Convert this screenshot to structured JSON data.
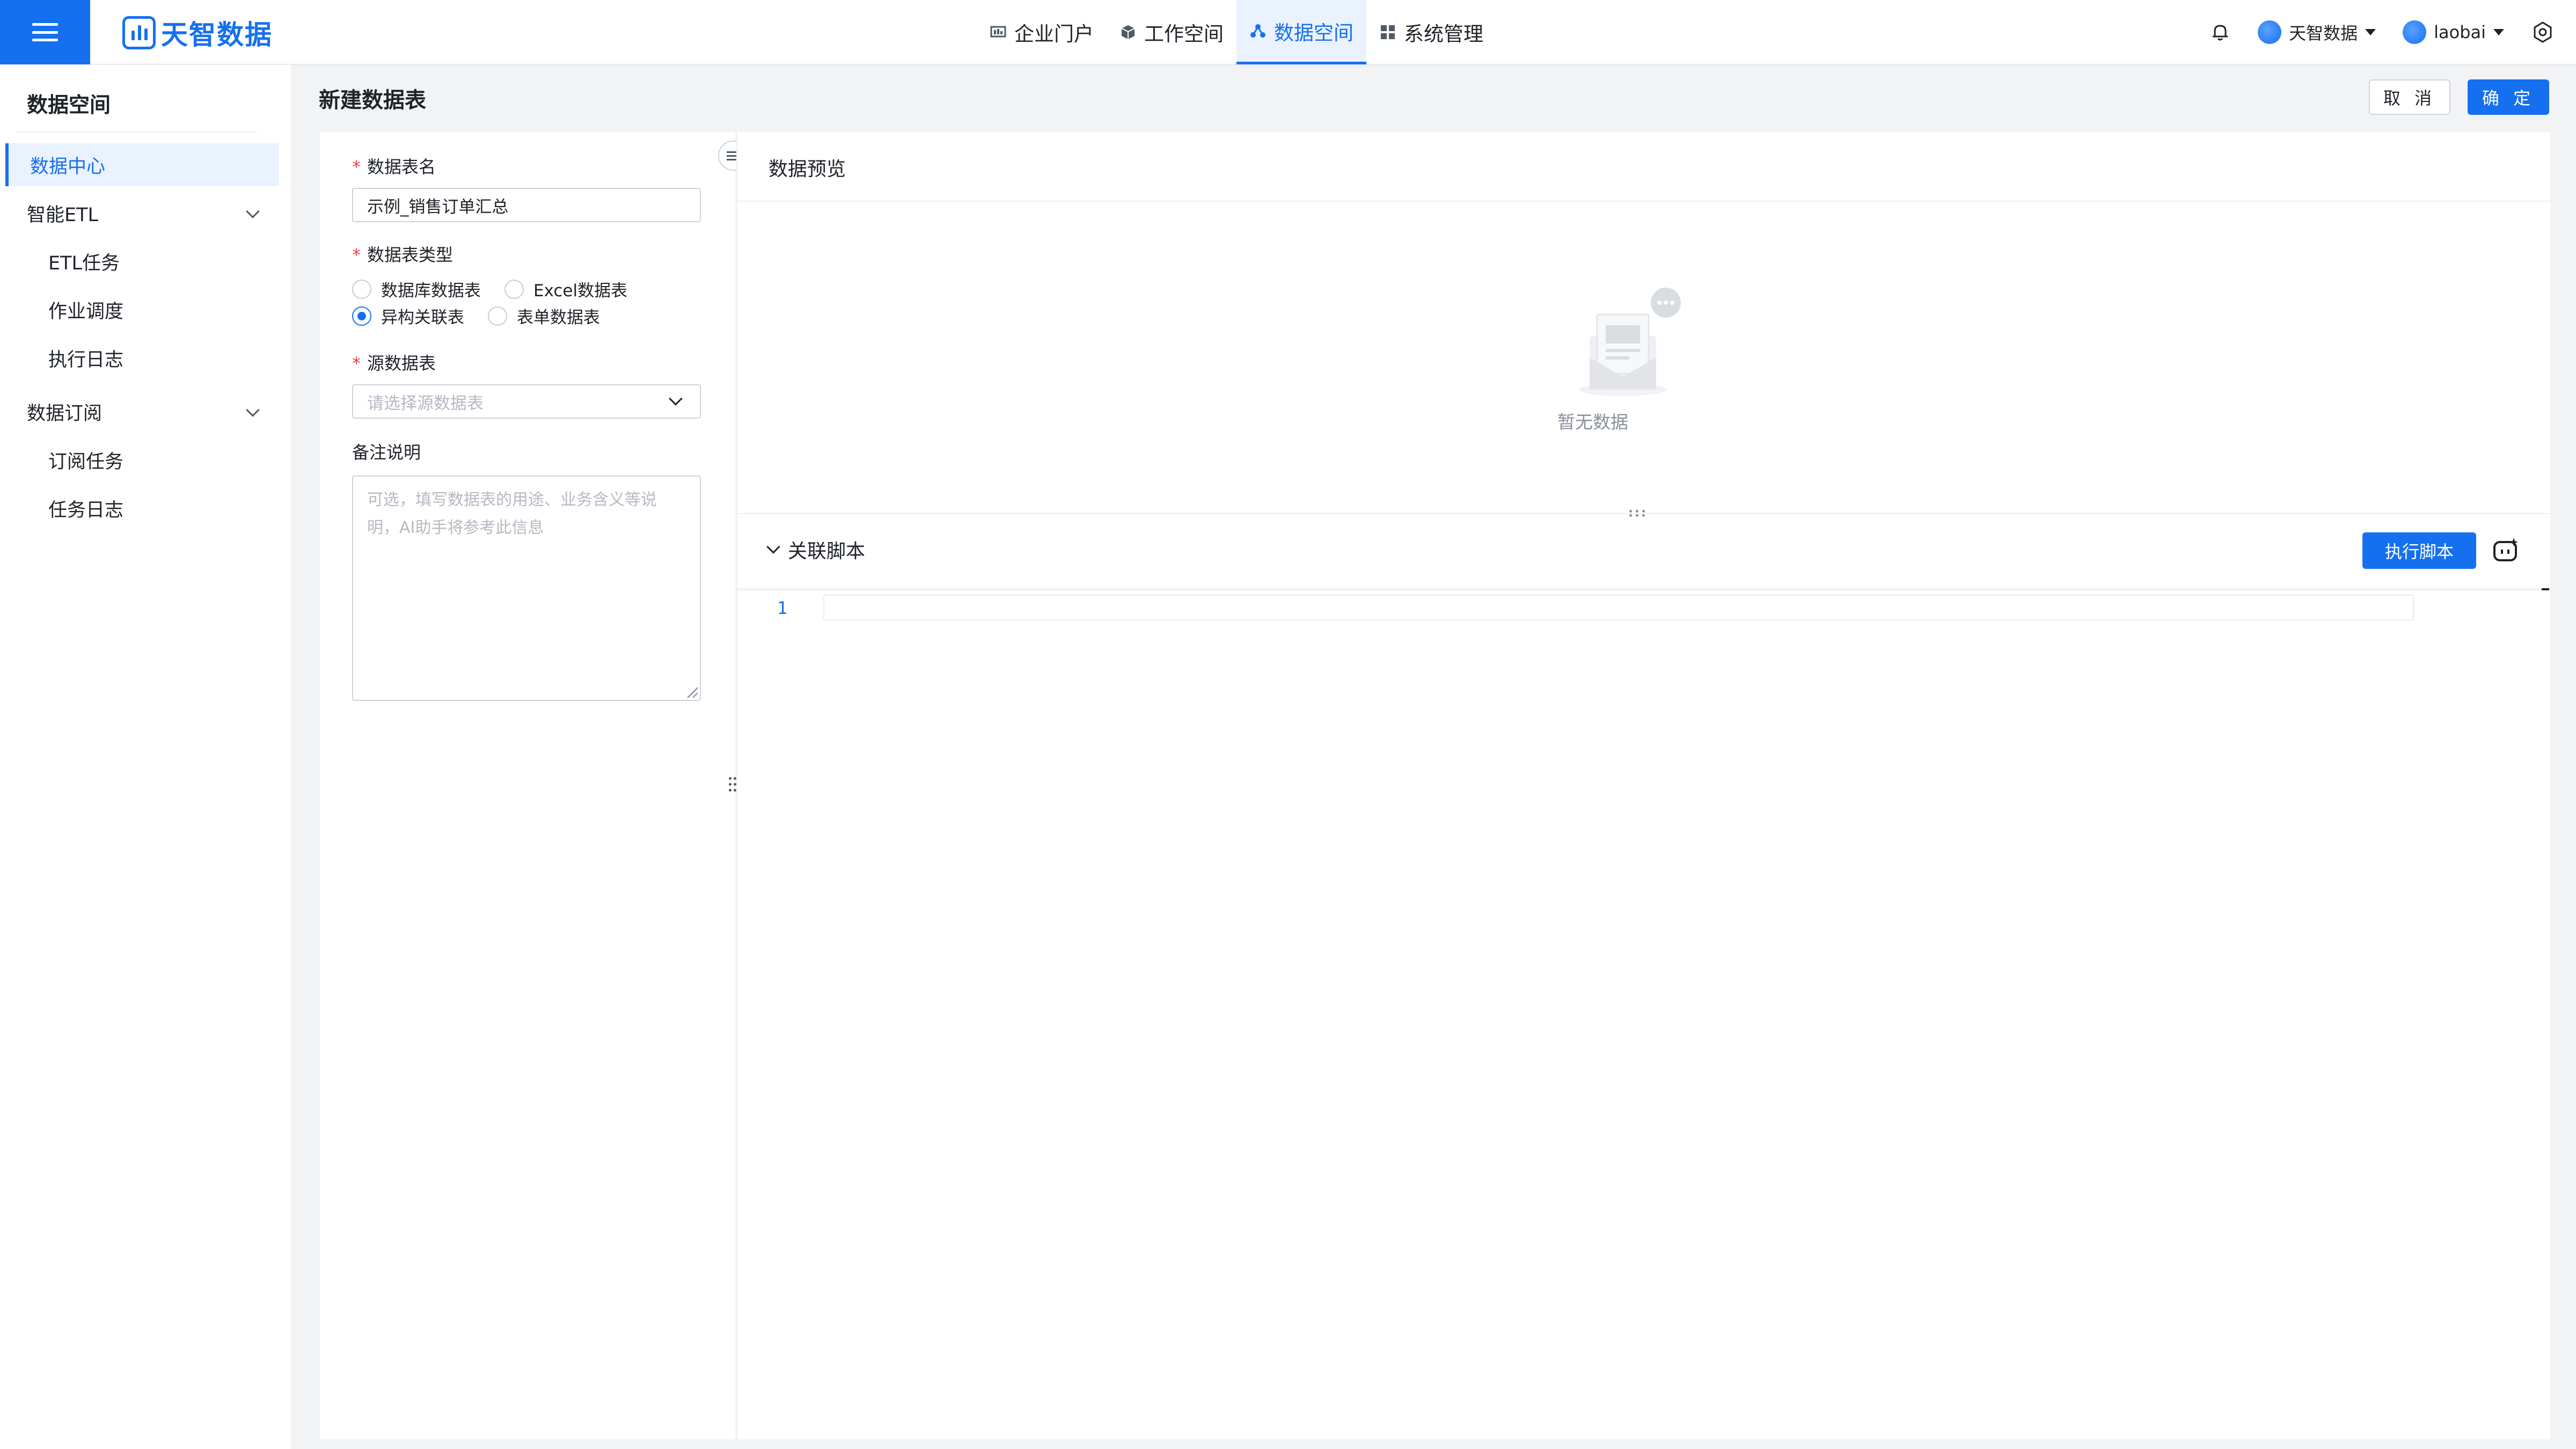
{
  "app": {
    "brand": "天智数据"
  },
  "nav": {
    "items": [
      {
        "label": "企业门户",
        "icon": "portal-icon"
      },
      {
        "label": "工作空间",
        "icon": "cube-icon"
      },
      {
        "label": "数据空间",
        "icon": "data-space-icon",
        "active": true
      },
      {
        "label": "系统管理",
        "icon": "grid-icon"
      }
    ]
  },
  "topright": {
    "org": "天智数据",
    "user": "laobai"
  },
  "sidebar": {
    "title": "数据空间",
    "items": [
      {
        "label": "数据中心",
        "active": true
      },
      {
        "label": "智能ETL",
        "expandable": true
      },
      {
        "label": "ETL任务",
        "sub": true
      },
      {
        "label": "作业调度",
        "sub": true
      },
      {
        "label": "执行日志",
        "sub": true
      },
      {
        "label": "数据订阅",
        "expandable": true
      },
      {
        "label": "订阅任务",
        "sub": true
      },
      {
        "label": "任务日志",
        "sub": true
      }
    ]
  },
  "page": {
    "title": "新建数据表",
    "cancel": "取 消",
    "confirm": "确 定"
  },
  "form": {
    "name_label": "数据表名",
    "name_value": "示例_销售订单汇总",
    "type_label": "数据表类型",
    "type_options": [
      "数据库数据表",
      "Excel数据表",
      "异构关联表",
      "表单数据表"
    ],
    "type_selected": "异构关联表",
    "source_label": "源数据表",
    "source_placeholder": "请选择源数据表",
    "note_label": "备注说明",
    "note_placeholder": "可选，填写数据表的用途、业务含义等说明，AI助手将参考此信息"
  },
  "preview": {
    "title": "数据预览",
    "empty_text": "暂无数据"
  },
  "script": {
    "title": "关联脚本",
    "run_button": "执行脚本",
    "line_number": "1"
  },
  "colors": {
    "primary": "#1570ef",
    "required": "#f53f3f"
  }
}
